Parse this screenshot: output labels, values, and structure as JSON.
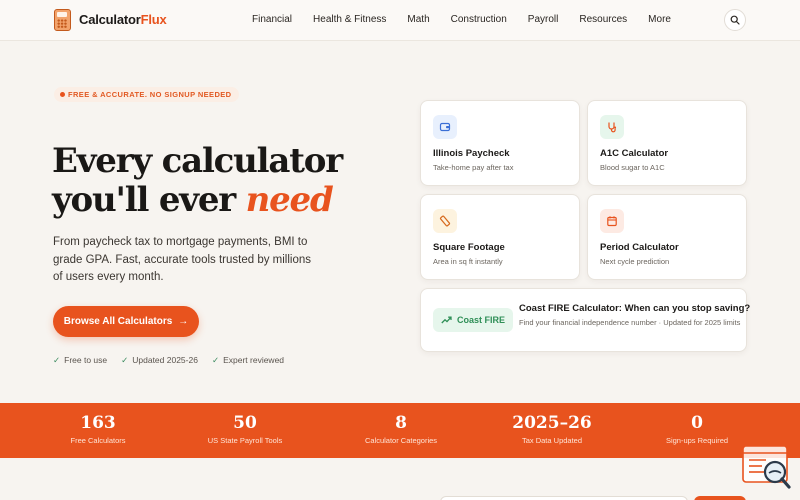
{
  "brand": {
    "name_part1": "Calculator",
    "name_part2": "Flux",
    "color": "#e8531e"
  },
  "nav": {
    "items": [
      "Financial",
      "Health & Fitness",
      "Math",
      "Construction",
      "Payroll",
      "Resources",
      "More"
    ],
    "search_icon": "search-icon"
  },
  "hero": {
    "badge": "FREE & ACCURATE. NO SIGNUP NEEDED",
    "title_line1": "Every calculator",
    "title_line2_plain": "you'll ever",
    "title_line2_accent": "need",
    "description": "From paycheck tax to mortgage payments, BMI to grade GPA. Fast, accurate tools trusted by millions of users every month.",
    "cta_label": "Browse All Calculators",
    "cta_icon": "arrow-right-icon",
    "checks": [
      "Free to use",
      "Updated 2025-26",
      "Expert reviewed"
    ]
  },
  "cards": [
    {
      "title": "Illinois Paycheck",
      "subtitle": "Take-home pay after tax",
      "icon": "wallet-icon",
      "icon_bg": "#e8f0fd",
      "icon_color": "#3b6fd6"
    },
    {
      "title": "A1C Calculator",
      "subtitle": "Blood sugar to A1C",
      "icon": "stethoscope-icon",
      "icon_bg": "#e6f6ec",
      "icon_color": "#e8531e"
    },
    {
      "title": "Square Footage",
      "subtitle": "Area in sq ft instantly",
      "icon": "ruler-icon",
      "icon_bg": "#fdf3df",
      "icon_color": "#d66a1e"
    },
    {
      "title": "Period Calculator",
      "subtitle": "Next cycle prediction",
      "icon": "calendar-icon",
      "icon_bg": "#fdeae3",
      "icon_color": "#e8531e"
    }
  ],
  "featured": {
    "pill_label": "Coast FIRE",
    "pill_icon": "trending-up-icon",
    "title": "Coast FIRE Calculator: When can you stop saving?",
    "subtitle": "Find your financial independence number · Updated for 2025 limits"
  },
  "stats": [
    {
      "value": "163",
      "label": "Free Calculators"
    },
    {
      "value": "50",
      "label": "US State Payroll Tools"
    },
    {
      "value": "8",
      "label": "Calculator Categories"
    },
    {
      "value": "2025–26",
      "label": "Tax Data Updated"
    },
    {
      "value": "0",
      "label": "Sign-ups Required"
    }
  ]
}
